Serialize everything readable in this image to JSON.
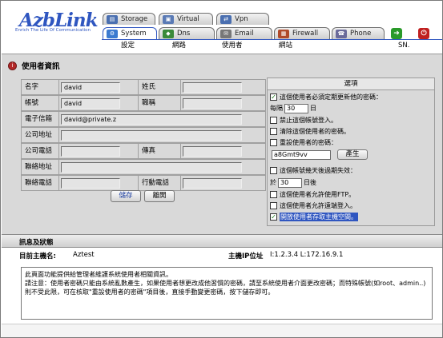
{
  "brand": {
    "logo": "AzbLink",
    "tagline": "Enrich The Life Of Communication"
  },
  "tabs_top": [
    {
      "label": "Storage"
    },
    {
      "label": "Virtual"
    },
    {
      "label": "Vpn"
    }
  ],
  "tabs_bottom": [
    {
      "label": "System"
    },
    {
      "label": "Dns"
    },
    {
      "label": "Email"
    },
    {
      "label": "Firewall"
    },
    {
      "label": "Phone"
    }
  ],
  "submenu": [
    {
      "label": "設定"
    },
    {
      "label": "網路"
    },
    {
      "label": "使用者"
    },
    {
      "label": "網站"
    },
    {
      "label": "SN."
    }
  ],
  "page_title": "使用者資訊",
  "form": {
    "name_label": "名字",
    "name_value": "david",
    "surname_label": "姓氏",
    "surname_value": "",
    "account_label": "帳號",
    "account_value": "david",
    "title_label": "職稱",
    "title_value": "",
    "email_label": "電子信箱",
    "email_value": "david@private.z",
    "company_address_label": "公司地址",
    "company_address_value": "",
    "company_phone_label": "公司電話",
    "company_phone_value": "",
    "fax_label": "傳真",
    "fax_value": "",
    "contact_address_label": "聯絡地址",
    "contact_address_value": "",
    "contact_phone_label": "聯絡電話",
    "contact_phone_value": "",
    "mobile_label": "行動電話",
    "mobile_value": ""
  },
  "buttons": {
    "save": "儲存",
    "leave": "離開",
    "generate": "產生"
  },
  "options": {
    "header": "選項",
    "opt1": "這個使用者必須定期更新他的密碼：",
    "every_label": "每隔",
    "every_value": "30",
    "day_unit": "日",
    "opt2": "禁止這個帳號登入。",
    "opt3": "清除這個使用者的密碼。",
    "opt4": "重設使用者的密碼：",
    "password_value": "a8Gmt9vv",
    "opt5": "這個帳號幾天後過期失效：",
    "in_label": "於",
    "in_value": "30",
    "after_days": "日後",
    "opt6": "這個使用者允許使用FTP。",
    "opt7": "這個使用者允許遠端登入。",
    "opt8": "開放使用者存取主機空間。"
  },
  "status": {
    "section_title": "訊息及狀態",
    "host_label": "目前主機名:",
    "host_value": "Aztest",
    "ip_label": "主機IP位址",
    "ip_value": "I:1.2.3.4  L:172.16.9.1"
  },
  "message": "此頁面功能提供給管理者維護系統使用者相關資訊。\n請注意：使用者密碼只能由系統亂數產生，如果使用者想更改成他習慣的密碼，請至系統使用者介面更改密碼；而特殊帳號(如root、admin..)則不受此限，可在核取\"重設使用者的密碼\"項目後，直接手動變更密碼，按下儲存即可。",
  "colors": {
    "brand_blue": "#2f56c0",
    "panel_gray": "#d9d9d9",
    "exit_red": "#c02020",
    "nav_green": "#2a9a2a"
  }
}
